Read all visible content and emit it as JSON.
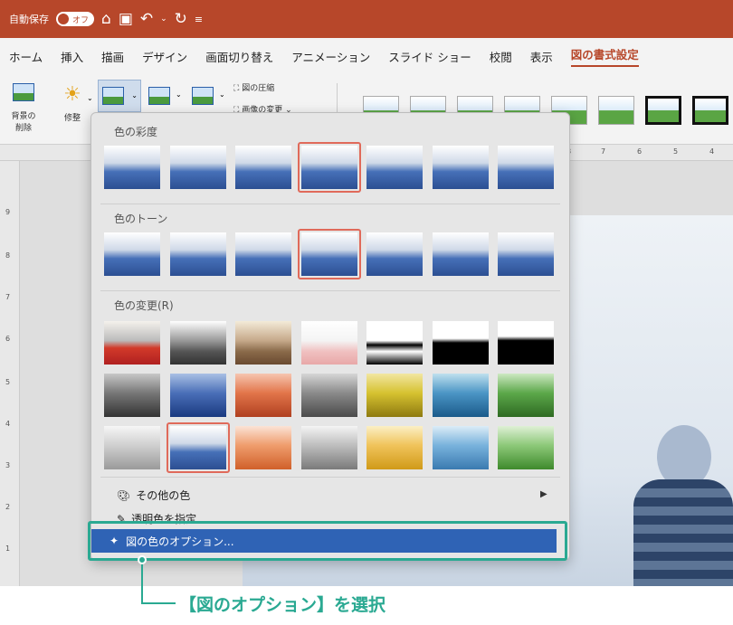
{
  "titlebar": {
    "autosave_label": "自動保存",
    "toggle_label": "オフ",
    "icons": [
      "home-icon",
      "save-icon",
      "undo-icon",
      "redo-icon",
      "customize-icon"
    ]
  },
  "menu": {
    "tabs": [
      "ホーム",
      "挿入",
      "描画",
      "デザイン",
      "画面切り替え",
      "アニメーション",
      "スライド ショー",
      "校閲",
      "表示",
      "図の書式設定"
    ],
    "active_index": 9
  },
  "ribbon": {
    "remove_bg_label_1": "背景の",
    "remove_bg_label_2": "削除",
    "corrections_label": "修整",
    "compress_label": "図の圧縮",
    "change_picture_label": "画像の変更"
  },
  "ruler": {
    "ticks_top": [
      "8",
      "7",
      "6",
      "5",
      "4"
    ],
    "ticks_left": [
      "9",
      "8",
      "7",
      "6",
      "5",
      "4",
      "3",
      "2",
      "1"
    ]
  },
  "color_panel": {
    "saturation_title": "色の彩度",
    "tone_title": "色のトーン",
    "recolor_title": "色の変更(R)",
    "saturation_selected": 3,
    "tone_selected": 3,
    "recolor_selected_row": 2,
    "recolor_selected_col": 1,
    "more_colors_label": "その他の色",
    "set_transparent_label": "透明色を指定",
    "options_label": "図の色のオプション..."
  },
  "annotation": {
    "text": "【図のオプション】を選択"
  },
  "colors": {
    "accent": "#b7472a",
    "highlight": "#2f63b5",
    "annotation": "#2aa992",
    "selection": "#e06a5a"
  }
}
